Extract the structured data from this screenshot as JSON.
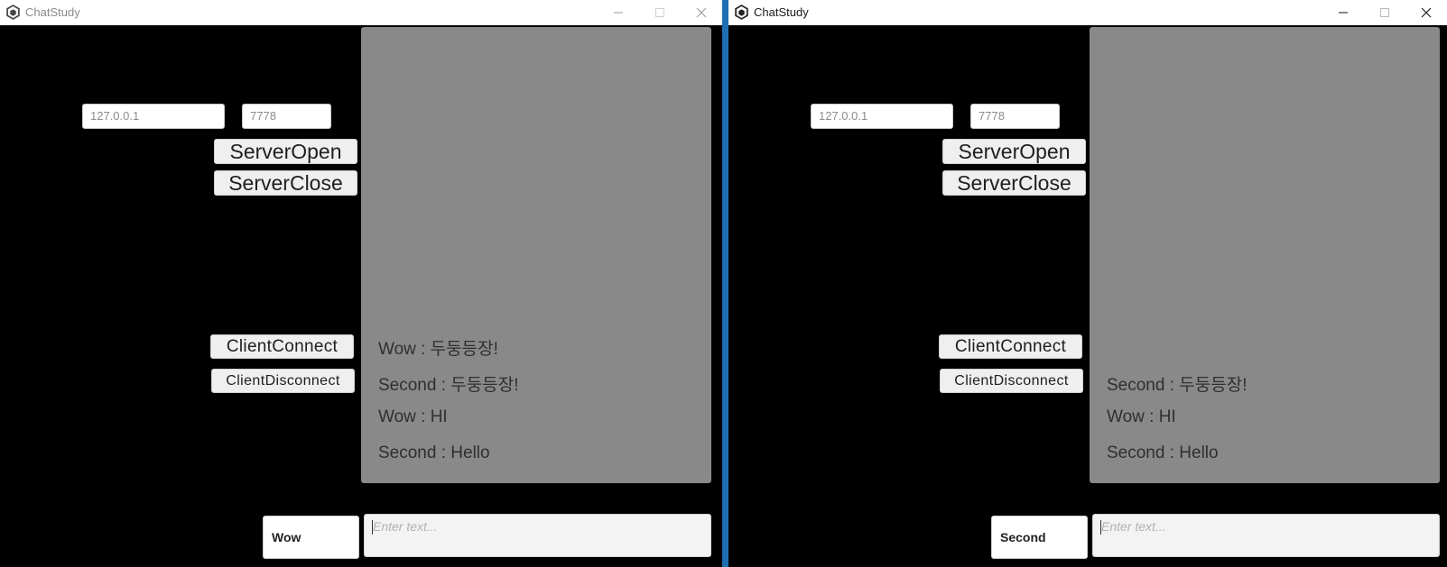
{
  "windows": [
    {
      "title": "ChatStudy",
      "ip_value": "127.0.0.1",
      "port_value": "7778",
      "buttons": {
        "server_open": "ServerOpen",
        "server_close": "ServerClose",
        "client_connect": "ClientConnect",
        "client_disconnect": "ClientDisconnect"
      },
      "messages": [
        "Wow :  두둥등장!",
        "Second :  두둥등장!",
        "Wow : HI",
        "Second : Hello"
      ],
      "nickname": "Wow",
      "input_placeholder": "Enter text..."
    },
    {
      "title": "ChatStudy",
      "ip_value": "127.0.0.1",
      "port_value": "7778",
      "buttons": {
        "server_open": "ServerOpen",
        "server_close": "ServerClose",
        "client_connect": "ClientConnect",
        "client_disconnect": "ClientDisconnect"
      },
      "messages": [
        "Second :  두둥등장!",
        "Wow : HI",
        "Second : Hello"
      ],
      "nickname": "Second",
      "input_placeholder": "Enter text..."
    }
  ],
  "colors": {
    "window_bg": "#000000",
    "chat_panel": "#898989",
    "divider": "#1e6fb3"
  },
  "icons": [
    "app-icon",
    "minimize-icon",
    "maximize-icon",
    "close-icon"
  ]
}
